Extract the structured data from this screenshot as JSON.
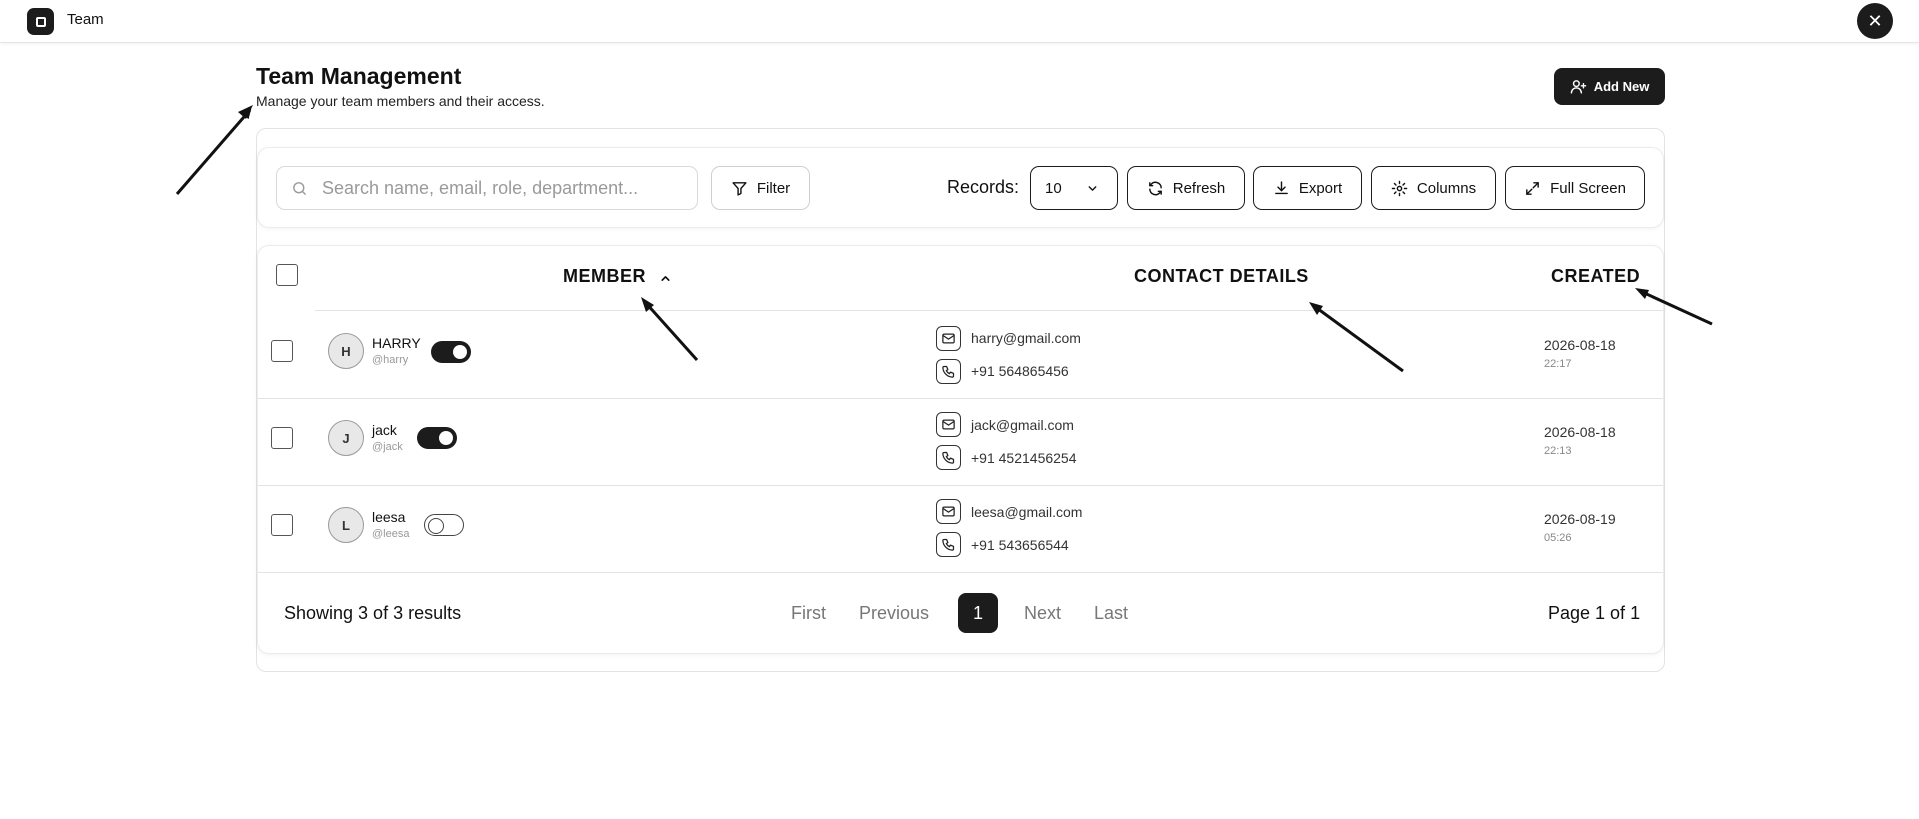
{
  "app": {
    "title": "Team",
    "close_icon": "close-icon",
    "logo_icon": "square-icon"
  },
  "header": {
    "title": "Team Management",
    "subtitle": "Manage your team members and their access.",
    "add_button": "Add New",
    "add_icon": "user-plus-icon"
  },
  "toolbar": {
    "search_placeholder": "Search name, email, role, department...",
    "filter_label": "Filter",
    "records_label": "Records:",
    "records_value": "10",
    "refresh_label": "Refresh",
    "export_label": "Export",
    "columns_label": "Columns",
    "fullscreen_label": "Full Screen"
  },
  "table": {
    "columns": [
      "MEMBER",
      "CONTACT DETAILS",
      "CREATED"
    ],
    "sort_icon": "chevron-up-icon",
    "rows": [
      {
        "initial": "H",
        "name": "HARRY",
        "handle": "@harry",
        "active": true,
        "email": "harry@gmail.com",
        "phone": "+91 564865456",
        "date": "2026-08-18",
        "time": "22:17"
      },
      {
        "initial": "J",
        "name": "jack",
        "handle": "@jack",
        "active": true,
        "email": "jack@gmail.com",
        "phone": "+91 4521456254",
        "date": "2026-08-18",
        "time": "22:13"
      },
      {
        "initial": "L",
        "name": "leesa",
        "handle": "@leesa",
        "active": false,
        "email": "leesa@gmail.com",
        "phone": "+91 543656544",
        "date": "2026-08-19",
        "time": "05:26"
      }
    ]
  },
  "pagination": {
    "showing": "Showing 3 of 3 results",
    "first": "First",
    "previous": "Previous",
    "current": "1",
    "next": "Next",
    "last": "Last",
    "page_of": "Page 1 of 1"
  }
}
